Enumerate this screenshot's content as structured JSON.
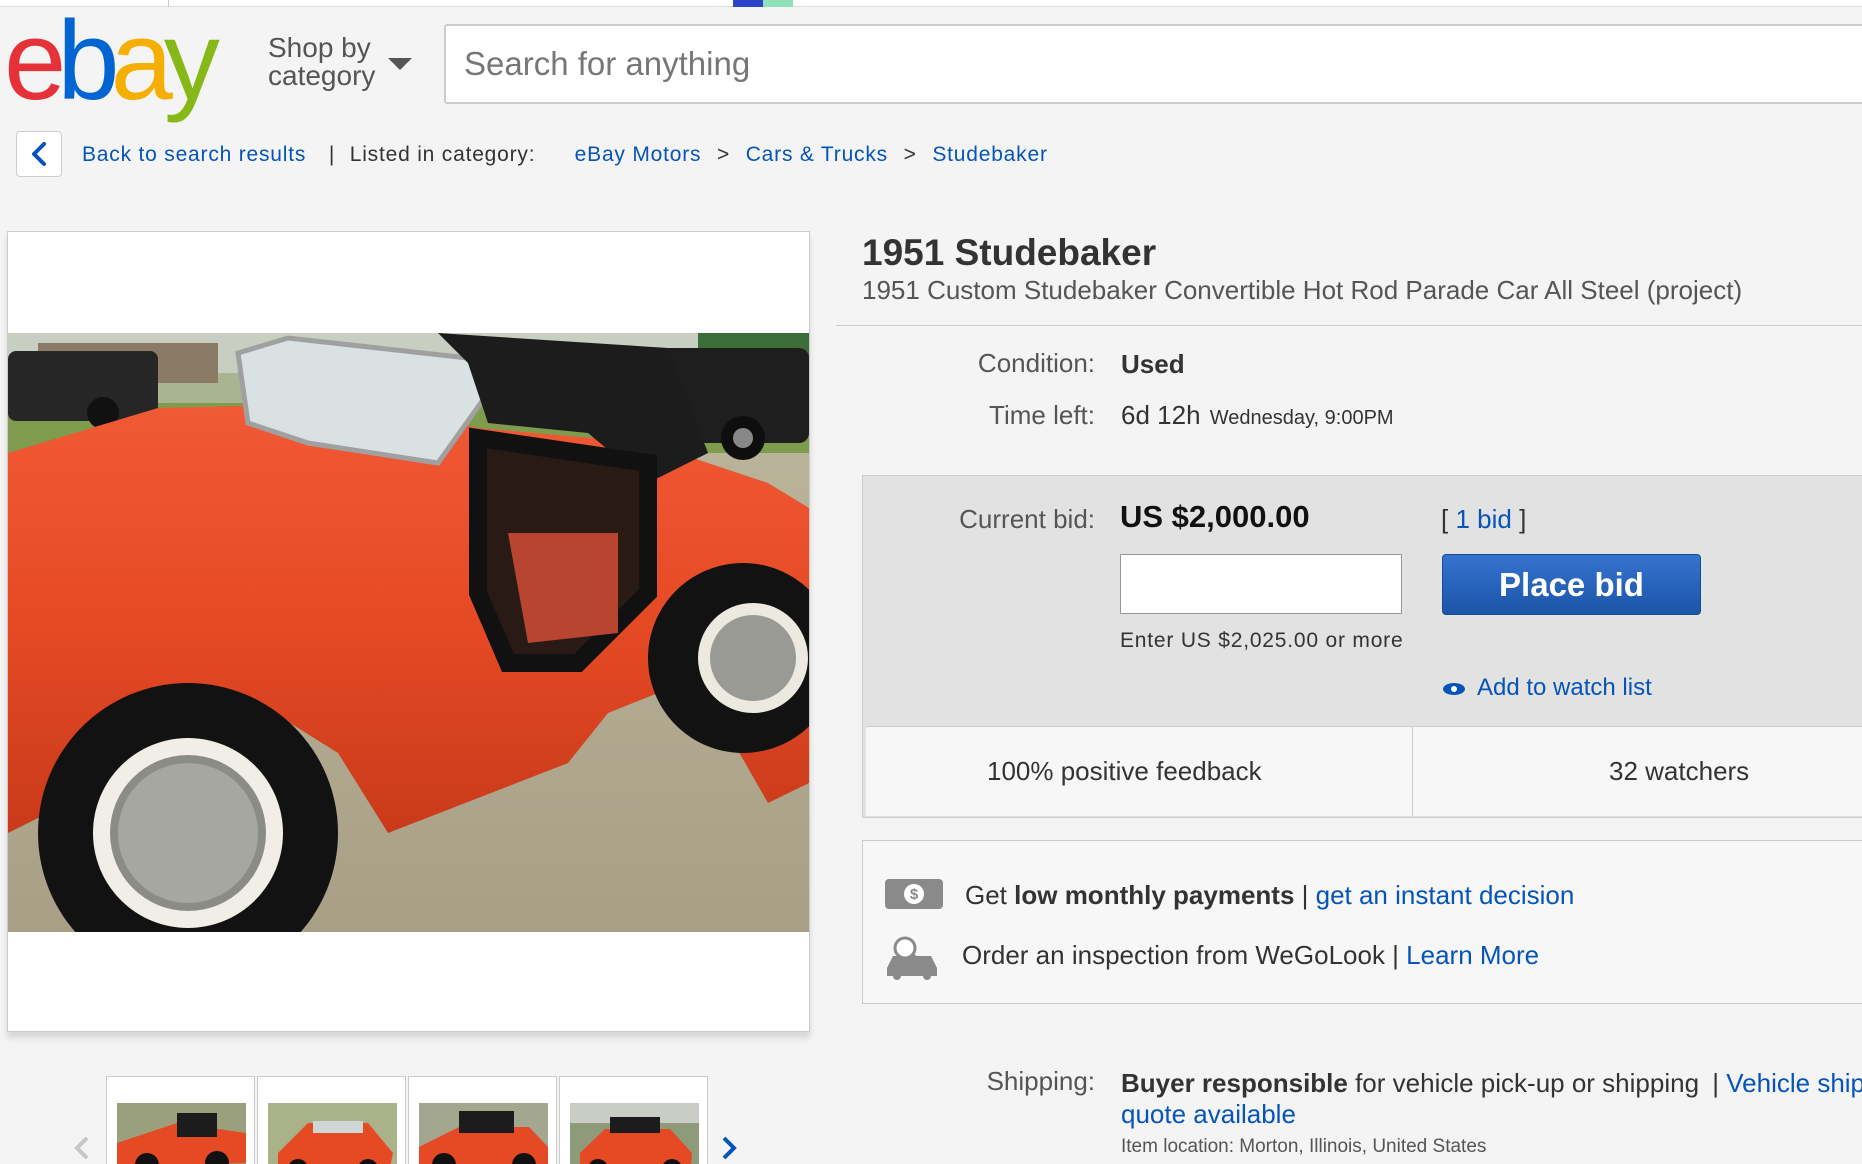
{
  "header": {
    "logo": {
      "e": "e",
      "b": "b",
      "a": "a",
      "y": "y"
    },
    "shop_by_line1": "Shop by",
    "shop_by_line2": "category",
    "search_placeholder": "Search for anything",
    "colors": {
      "logo_red": "#e53238",
      "logo_blue": "#0064d2",
      "logo_yellow": "#f5af02",
      "logo_green": "#86b817",
      "link": "#0654ba"
    }
  },
  "breadcrumb": {
    "back_label": "Back to search results",
    "listed_label": "Listed in category:",
    "categories": [
      "eBay Motors",
      "Cars & Trucks",
      "Studebaker"
    ],
    "separator": ">"
  },
  "listing": {
    "title": "1951 Studebaker",
    "subtitle": "1951 Custom Studebaker Convertible Hot Rod Parade Car All Steel (project)",
    "condition_label": "Condition:",
    "condition_value": "Used",
    "time_left_label": "Time left:",
    "time_left_value": "6d 12h",
    "time_left_end": "Wednesday, 9:00PM"
  },
  "bidding": {
    "current_bid_label": "Current bid:",
    "current_bid_value": "US $2,000.00",
    "bid_open": "[",
    "bid_count": "1 bid",
    "bid_close": "]",
    "min_bid_hint": "Enter US $2,025.00 or more",
    "place_bid_label": "Place bid",
    "watch_label": "Add to watch list",
    "feedback": "100% positive feedback",
    "watchers": "32 watchers"
  },
  "financing": {
    "pay_prefix": "Get ",
    "pay_bold": "low monthly payments",
    "pay_sep": " | ",
    "pay_link": "get an instant decision",
    "inspect_text": "Order an inspection from WeGoLook",
    "inspect_sep": " | ",
    "inspect_link": "Learn More"
  },
  "shipping": {
    "label": "Shipping:",
    "bold": "Buyer responsible",
    "text": " for vehicle pick-up or shipping",
    "sep": " | ",
    "link1": "Vehicle shipping",
    "link2": "quote available",
    "location_label": "Item location:",
    "location_value": "Morton, Illinois, United States"
  },
  "gallery": {
    "thumbnail_count": 4,
    "prev_icon": "chevron-left-icon",
    "next_icon": "chevron-right-icon"
  }
}
